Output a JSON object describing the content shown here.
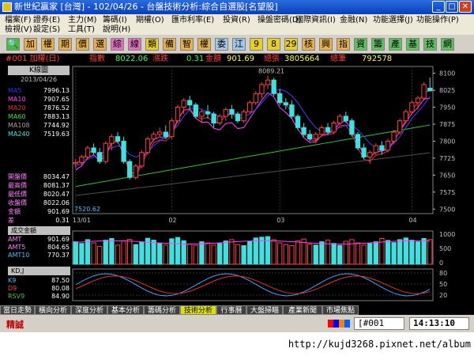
{
  "window": {
    "title": "新世紀贏家 [台灣] - 102/04/26 - 台盤技術分析:綜合自選股[名望股]"
  },
  "menu": [
    {
      "label": "檔案(F)"
    },
    {
      "label": "證券(E)"
    },
    {
      "label": "主力(M)"
    },
    {
      "label": "籌碼(I)"
    },
    {
      "label": "期權(O)"
    },
    {
      "label": "匯市利率(E)"
    },
    {
      "label": "投資(R)"
    },
    {
      "label": "操盤密碼(D)"
    },
    {
      "label": "國際資訊(I)"
    },
    {
      "label": "金融(N)"
    },
    {
      "label": "功能選擇(J)"
    },
    {
      "label": "功能操作(P)"
    },
    {
      "label": "檢視(V)"
    },
    {
      "label": "設定(S)"
    },
    {
      "label": "工具(T)"
    },
    {
      "label": "說明(H)"
    }
  ],
  "toolbar": [
    {
      "label": "加",
      "icon": "search-icon",
      "bg": "#40c040"
    },
    {
      "label": "加",
      "bg": "#e8b048"
    },
    {
      "label": "權",
      "bg": "#e8b048"
    },
    {
      "label": "期",
      "bg": "#e8b048"
    },
    {
      "label": "價",
      "bg": "#e8b048"
    },
    {
      "label": "選",
      "bg": "#e8b048"
    },
    {
      "label": "綜",
      "bg": "#e070c0"
    },
    {
      "label": "線",
      "bg": "#e070c0"
    },
    {
      "label": "類",
      "bg": "#e8d020"
    },
    {
      "label": "備",
      "bg": "#e8b048"
    },
    {
      "label": "智",
      "bg": "#e8b048"
    },
    {
      "label": "權",
      "bg": "#e8b048"
    },
    {
      "label": "委",
      "bg": "#a0c8e8"
    },
    {
      "label": "江",
      "bg": "#a0c8e8"
    },
    {
      "label": "9",
      "bg": "#e8d020"
    },
    {
      "label": "8",
      "bg": "#e8d020"
    },
    {
      "label": "29",
      "bg": "#e8d020"
    },
    {
      "label": "核",
      "bg": "#e8b048"
    },
    {
      "label": "興",
      "bg": "#e8b048"
    },
    {
      "label": "指",
      "bg": "#e8b048"
    },
    {
      "label": "資",
      "bg": "#60c060"
    },
    {
      "label": "籌",
      "bg": "#60c060"
    },
    {
      "label": "產",
      "bg": "#60c060"
    },
    {
      "label": "基",
      "bg": "#60c060"
    },
    {
      "label": "技",
      "bg": "#60c060"
    },
    {
      "label": "網",
      "bg": "#60c060"
    }
  ],
  "quote": {
    "symbol": "#001 加權(日)",
    "index_label": "指數",
    "index_value": "8022.06",
    "change_label": "漲跌",
    "change_value": "0.31",
    "amount_label": "金額",
    "amount_value": "901.69",
    "total_up_label": "總張",
    "total_up_value": "3805664",
    "total_count_label": "總筆",
    "total_count_value": "792578"
  },
  "left_panel": {
    "title": "K線圖",
    "date": "2013/04/26",
    "ma": [
      {
        "label": "MA5",
        "value": "7996.13",
        "color": "#3030ff"
      },
      {
        "label": "MA10",
        "value": "7907.65",
        "color": "#ff40ff"
      },
      {
        "label": "MA20",
        "value": "7876.52",
        "color": "#e03030"
      },
      {
        "label": "MA60",
        "value": "7883.13",
        "color": "#30e030"
      },
      {
        "label": "MA108",
        "value": "7744.92",
        "color": "#a0a0a0"
      },
      {
        "label": "MA240",
        "value": "7519.63",
        "color": "#40e0e0"
      }
    ],
    "prices": [
      {
        "label": "開盤價",
        "value": "8034.47",
        "color": "#ff80ff"
      },
      {
        "label": "最高價",
        "value": "8081.37",
        "color": "#ff80ff"
      },
      {
        "label": "最低價",
        "value": "8020.47",
        "color": "#ff80ff"
      },
      {
        "label": "收盤價",
        "value": "8022.06",
        "color": "#ff80ff"
      },
      {
        "label": "金額",
        "value": "901.69",
        "color": "#ff80ff"
      },
      {
        "label": "差",
        "value": "0.31",
        "color": "#ff80ff"
      }
    ]
  },
  "volume_panel": {
    "title": "成交金額",
    "rows": [
      {
        "label": "AMT",
        "value": "901.69"
      },
      {
        "label": "AMT5",
        "value": "804.65"
      },
      {
        "label": "AMT10",
        "value": "770.37"
      }
    ]
  },
  "kd_panel": {
    "title": "KD,J",
    "rows": [
      {
        "label": "K9",
        "value": "87.50"
      },
      {
        "label": "D9",
        "value": "80.08"
      },
      {
        "label": "RSV9",
        "value": "84.90"
      }
    ]
  },
  "chart_data": {
    "type": "candlestick",
    "price_axis": {
      "ticks": [
        "8100",
        "8025",
        "7950",
        "7875",
        "7800",
        "7725",
        "7650",
        "7575",
        "7500"
      ],
      "ylim": [
        7480,
        8130
      ]
    },
    "x_labels": [
      "13/01",
      "02",
      "03",
      "04"
    ],
    "x_label_index": [
      0,
      16,
      34,
      56
    ],
    "annotations": {
      "high": "8089.21",
      "low": "7520.62"
    },
    "candles": [
      [
        7700,
        7720,
        7680,
        7705
      ],
      [
        7705,
        7740,
        7690,
        7730
      ],
      [
        7730,
        7780,
        7720,
        7770
      ],
      [
        7770,
        7790,
        7740,
        7750
      ],
      [
        7750,
        7770,
        7700,
        7710
      ],
      [
        7710,
        7800,
        7700,
        7790
      ],
      [
        7790,
        7830,
        7760,
        7820
      ],
      [
        7820,
        7840,
        7790,
        7800
      ],
      [
        7800,
        7820,
        7700,
        7710
      ],
      [
        7710,
        7720,
        7630,
        7640
      ],
      [
        7640,
        7700,
        7630,
        7690
      ],
      [
        7690,
        7760,
        7680,
        7750
      ],
      [
        7750,
        7820,
        7740,
        7810
      ],
      [
        7810,
        7840,
        7800,
        7830
      ],
      [
        7830,
        7860,
        7820,
        7840
      ],
      [
        7840,
        7870,
        7810,
        7820
      ],
      [
        7820,
        7900,
        7810,
        7890
      ],
      [
        7890,
        7960,
        7880,
        7950
      ],
      [
        7950,
        7990,
        7920,
        7980
      ],
      [
        7980,
        8000,
        7940,
        7960
      ],
      [
        7960,
        7970,
        7900,
        7910
      ],
      [
        7910,
        7940,
        7880,
        7930
      ],
      [
        7930,
        7960,
        7900,
        7920
      ],
      [
        7920,
        7930,
        7860,
        7880
      ],
      [
        7880,
        7920,
        7870,
        7910
      ],
      [
        7910,
        7950,
        7890,
        7940
      ],
      [
        7940,
        7960,
        7900,
        7920
      ],
      [
        7920,
        7930,
        7880,
        7890
      ],
      [
        7890,
        7940,
        7880,
        7930
      ],
      [
        7930,
        7980,
        7920,
        7970
      ],
      [
        7970,
        8020,
        7960,
        8010
      ],
      [
        8010,
        8060,
        7990,
        8050
      ],
      [
        8050,
        8089,
        8030,
        8070
      ],
      [
        8070,
        8080,
        8000,
        8010
      ],
      [
        8010,
        8030,
        7960,
        7970
      ],
      [
        7970,
        7990,
        7940,
        7960
      ],
      [
        7960,
        7980,
        7900,
        7910
      ],
      [
        7910,
        7920,
        7850,
        7860
      ],
      [
        7860,
        7880,
        7820,
        7830
      ],
      [
        7830,
        7850,
        7800,
        7810
      ],
      [
        7810,
        7840,
        7790,
        7830
      ],
      [
        7830,
        7870,
        7820,
        7860
      ],
      [
        7860,
        7880,
        7830,
        7840
      ],
      [
        7840,
        7890,
        7830,
        7880
      ],
      [
        7880,
        7920,
        7870,
        7910
      ],
      [
        7910,
        7930,
        7880,
        7890
      ],
      [
        7890,
        7900,
        7820,
        7830
      ],
      [
        7830,
        7840,
        7760,
        7770
      ],
      [
        7770,
        7790,
        7720,
        7730
      ],
      [
        7730,
        7760,
        7700,
        7750
      ],
      [
        7750,
        7790,
        7740,
        7780
      ],
      [
        7780,
        7800,
        7740,
        7760
      ],
      [
        7760,
        7810,
        7750,
        7800
      ],
      [
        7800,
        7850,
        7790,
        7840
      ],
      [
        7840,
        7900,
        7830,
        7890
      ],
      [
        7890,
        7940,
        7880,
        7930
      ],
      [
        7930,
        7980,
        7920,
        7970
      ],
      [
        7970,
        8000,
        7940,
        7990
      ],
      [
        7990,
        8060,
        7980,
        8050
      ],
      [
        8034,
        8081,
        8020,
        8022
      ]
    ],
    "volume": [
      820,
      760,
      900,
      780,
      650,
      880,
      940,
      700,
      860,
      910,
      720,
      800,
      950,
      880,
      760,
      700,
      930,
      980,
      860,
      740,
      690,
      820,
      780,
      700,
      760,
      850,
      900,
      720,
      680,
      840,
      960,
      990,
      1010,
      900,
      780,
      720,
      680,
      860,
      920,
      740,
      700,
      820,
      880,
      760,
      690,
      840,
      900,
      780,
      700,
      760,
      820,
      940,
      870,
      790,
      900,
      960,
      880,
      820,
      940,
      902
    ],
    "ma5": [
      7690,
      7700,
      7720,
      7730,
      7740,
      7760,
      7770,
      7780,
      7770,
      7740,
      7730,
      7740,
      7750,
      7780,
      7800,
      7820,
      7840,
      7870,
      7910,
      7940,
      7950,
      7940,
      7930,
      7920,
      7910,
      7910,
      7920,
      7920,
      7910,
      7920,
      7940,
      7970,
      8000,
      8020,
      8030,
      8020,
      8000,
      7970,
      7930,
      7890,
      7860,
      7840,
      7840,
      7850,
      7860,
      7870,
      7870,
      7850,
      7820,
      7790,
      7770,
      7760,
      7770,
      7790,
      7820,
      7860,
      7900,
      7930,
      7960,
      7996
    ]
  }
}
